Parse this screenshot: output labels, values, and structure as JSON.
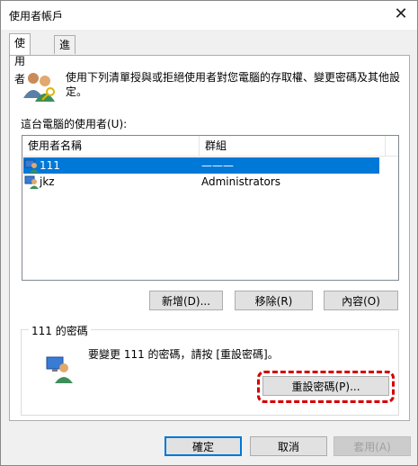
{
  "window": {
    "title": "使用者帳戶",
    "close_glyph": "✕"
  },
  "tabs": [
    {
      "label": "使用者"
    },
    {
      "label": "進階"
    }
  ],
  "description": "使用下列清單授與或拒絕使用者對您電腦的存取權、變更密碼及其他設定。",
  "users_label": "這台電腦的使用者(U):",
  "table": {
    "headers": [
      "使用者名稱",
      "群組"
    ],
    "rows": [
      {
        "name": "111",
        "group": "———",
        "selected": true
      },
      {
        "name": "jkz",
        "group": "Administrators",
        "selected": false
      }
    ]
  },
  "user_buttons": {
    "add": "新增(D)...",
    "remove": "移除(R)",
    "properties": "內容(O)"
  },
  "password_group": {
    "title": "111 的密碼",
    "text": "要變更 111 的密碼，請按 [重設密碼]。",
    "reset_button": "重設密碼(P)..."
  },
  "footer_buttons": {
    "ok": "確定",
    "cancel": "取消",
    "apply": "套用(A)"
  },
  "colors": {
    "selection": "#0078d7",
    "highlight": "#d40000"
  },
  "icons": [
    "users-icon",
    "user-icon",
    "password-user-icon",
    "close-icon"
  ]
}
